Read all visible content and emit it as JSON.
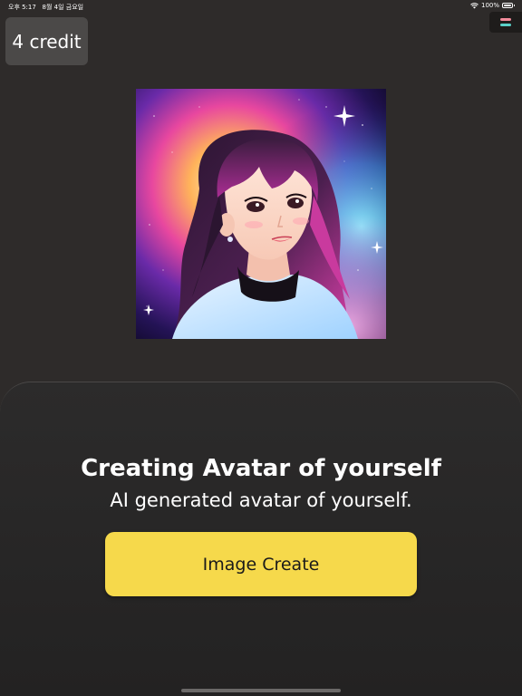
{
  "status_bar": {
    "time": "오후 5:17",
    "date": "8월 4일 금요일",
    "battery_percent": "100%",
    "battery_level": 1.0
  },
  "header": {
    "credit_label": "4 credit",
    "menu_icon": "menu-icon",
    "menu_colors": [
      "#f28b9b",
      "#5ad0c8"
    ]
  },
  "avatar": {
    "icon": "anime-girl-avatar-image"
  },
  "sheet": {
    "title": "Creating Avatar of yourself",
    "subtitle": "AI generated avatar of yourself.",
    "create_button_label": "Image Create"
  },
  "colors": {
    "background": "#2e2b2a",
    "accent": "#f6d94b"
  }
}
